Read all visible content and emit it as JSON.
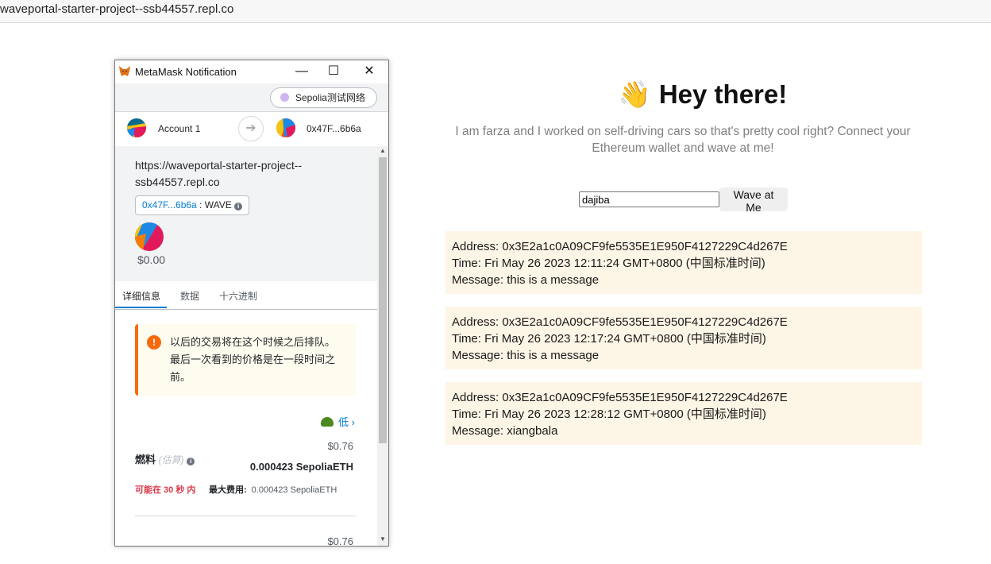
{
  "browser": {
    "url": "waveportal-starter-project--ssb44557.repl.co"
  },
  "page": {
    "wave_emoji": "👋",
    "title": "Hey there!",
    "subtitle": "I am farza and I worked on self-driving cars so that's pretty cool right? Connect your Ethereum wallet and wave at me!",
    "input_value": "dajiba",
    "wave_button": "Wave at Me",
    "messages": [
      {
        "address": "Address: 0x3E2a1c0A09CF9fe5535E1E950F4127229C4d267E",
        "time": "Time: Fri May 26 2023 12:11:24 GMT+0800 (中国标准时间)",
        "message": "Message: this is a message"
      },
      {
        "address": "Address: 0x3E2a1c0A09CF9fe5535E1E950F4127229C4d267E",
        "time": "Time: Fri May 26 2023 12:17:24 GMT+0800 (中国标准时间)",
        "message": "Message: this is a message"
      },
      {
        "address": "Address: 0x3E2a1c0A09CF9fe5535E1E950F4127229C4d267E",
        "time": "Time: Fri May 26 2023 12:28:12 GMT+0800 (中国标准时间)",
        "message": "Message: xiangbala"
      }
    ]
  },
  "metamask": {
    "window_title": "MetaMask Notification",
    "window_controls": {
      "minimize": "—",
      "maximize": "☐",
      "close": "✕"
    },
    "network": "Sepolia测试网络",
    "from_account": "Account 1",
    "to_account": "0x47F...6b6a",
    "origin": "https://waveportal-starter-project--ssb44557.repl.co",
    "contract_address": "0x47F...6b6a",
    "method_sep": " : ",
    "method": "WAVE",
    "amount": "$0.00",
    "tabs": [
      "详细信息",
      "数据",
      "十六进制"
    ],
    "warning": "以后的交易将在这个时候之后排队。最后一次看到的价格是在一段时间之前。",
    "speed_label": "低",
    "gas_usd": "$0.76",
    "gas_label": "燃料",
    "gas_est": "(估算)",
    "gas_eth": "0.000423 SepoliaETH",
    "likely": "可能在 30 秒 内",
    "max_fee_label": "最大费用:",
    "max_fee_value": "0.000423 SepoliaETH",
    "total_usd": "$0.76"
  },
  "colors": {
    "accent": "#037dd6",
    "warning": "#f66a0a",
    "message_bg": "#fdf5e6"
  },
  "icons": [
    "metamask-fox-icon",
    "arrow-right-icon",
    "info-icon",
    "warning-icon",
    "turtle-icon",
    "chevron-right-icon"
  ]
}
